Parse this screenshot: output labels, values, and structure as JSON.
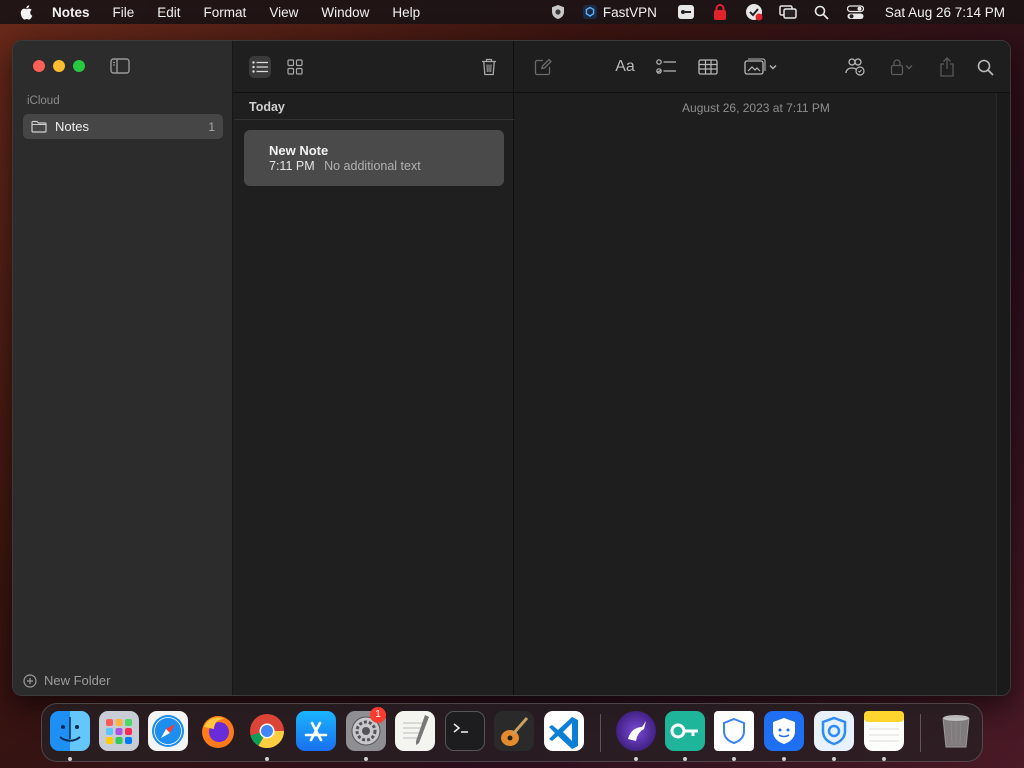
{
  "menubar": {
    "app_name": "Notes",
    "menus": [
      "File",
      "Edit",
      "Format",
      "View",
      "Window",
      "Help"
    ],
    "vpn_label": "FastVPN",
    "clock": "Sat Aug 26  7:14 PM"
  },
  "sidebar": {
    "section": "iCloud",
    "folder": {
      "name": "Notes",
      "count": "1"
    },
    "new_folder": "New Folder"
  },
  "list": {
    "section": "Today",
    "notes": [
      {
        "title": "New Note",
        "time": "7:11 PM",
        "preview": "No additional text"
      }
    ]
  },
  "editor": {
    "date": "August 26, 2023 at 7:11 PM",
    "format_label": "Aa"
  },
  "dock": {
    "settings_badge": "1"
  },
  "colors": {
    "close": "#fe5f57",
    "minimize": "#febc2e",
    "maximize": "#28c840",
    "badge": "#ff3b30"
  }
}
